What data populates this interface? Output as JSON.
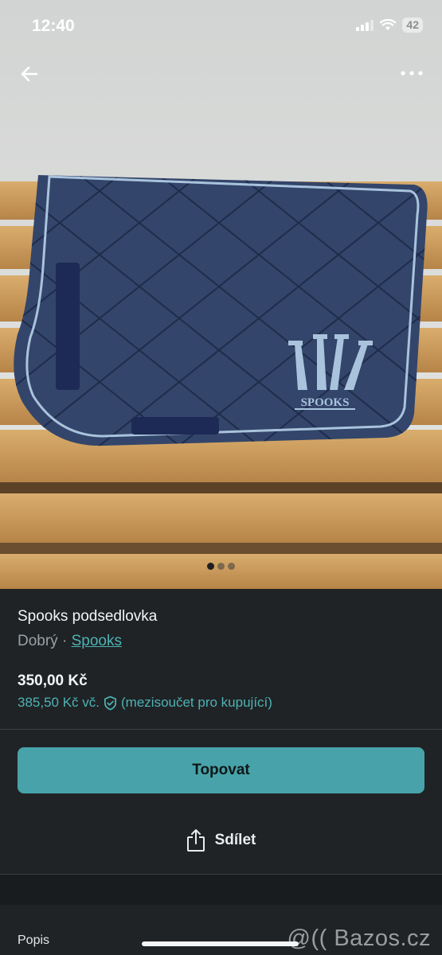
{
  "status_bar": {
    "time": "12:40",
    "battery": "42"
  },
  "nav": {
    "back_icon": "arrow-left-icon",
    "more_icon": "more-horizontal-icon"
  },
  "photo": {
    "logo_text": "SPOOKS",
    "pager_total": 3,
    "pager_active": 1
  },
  "listing": {
    "title": "Spooks podsedlovka",
    "condition": "Dobrý",
    "separator": "·",
    "brand": "Spooks",
    "price": "350,00 Kč",
    "price_incl": "385,50 Kč vč.",
    "price_incl_note": "(mezisoučet pro kupující)"
  },
  "actions": {
    "topovat_label": "Topovat",
    "share_label": "Sdílet"
  },
  "section": {
    "description_label": "Popis"
  },
  "watermark": "@(( Bazos.cz",
  "colors": {
    "accent": "#47a3a9",
    "link": "#4fb2b5",
    "background": "#1f2325"
  }
}
